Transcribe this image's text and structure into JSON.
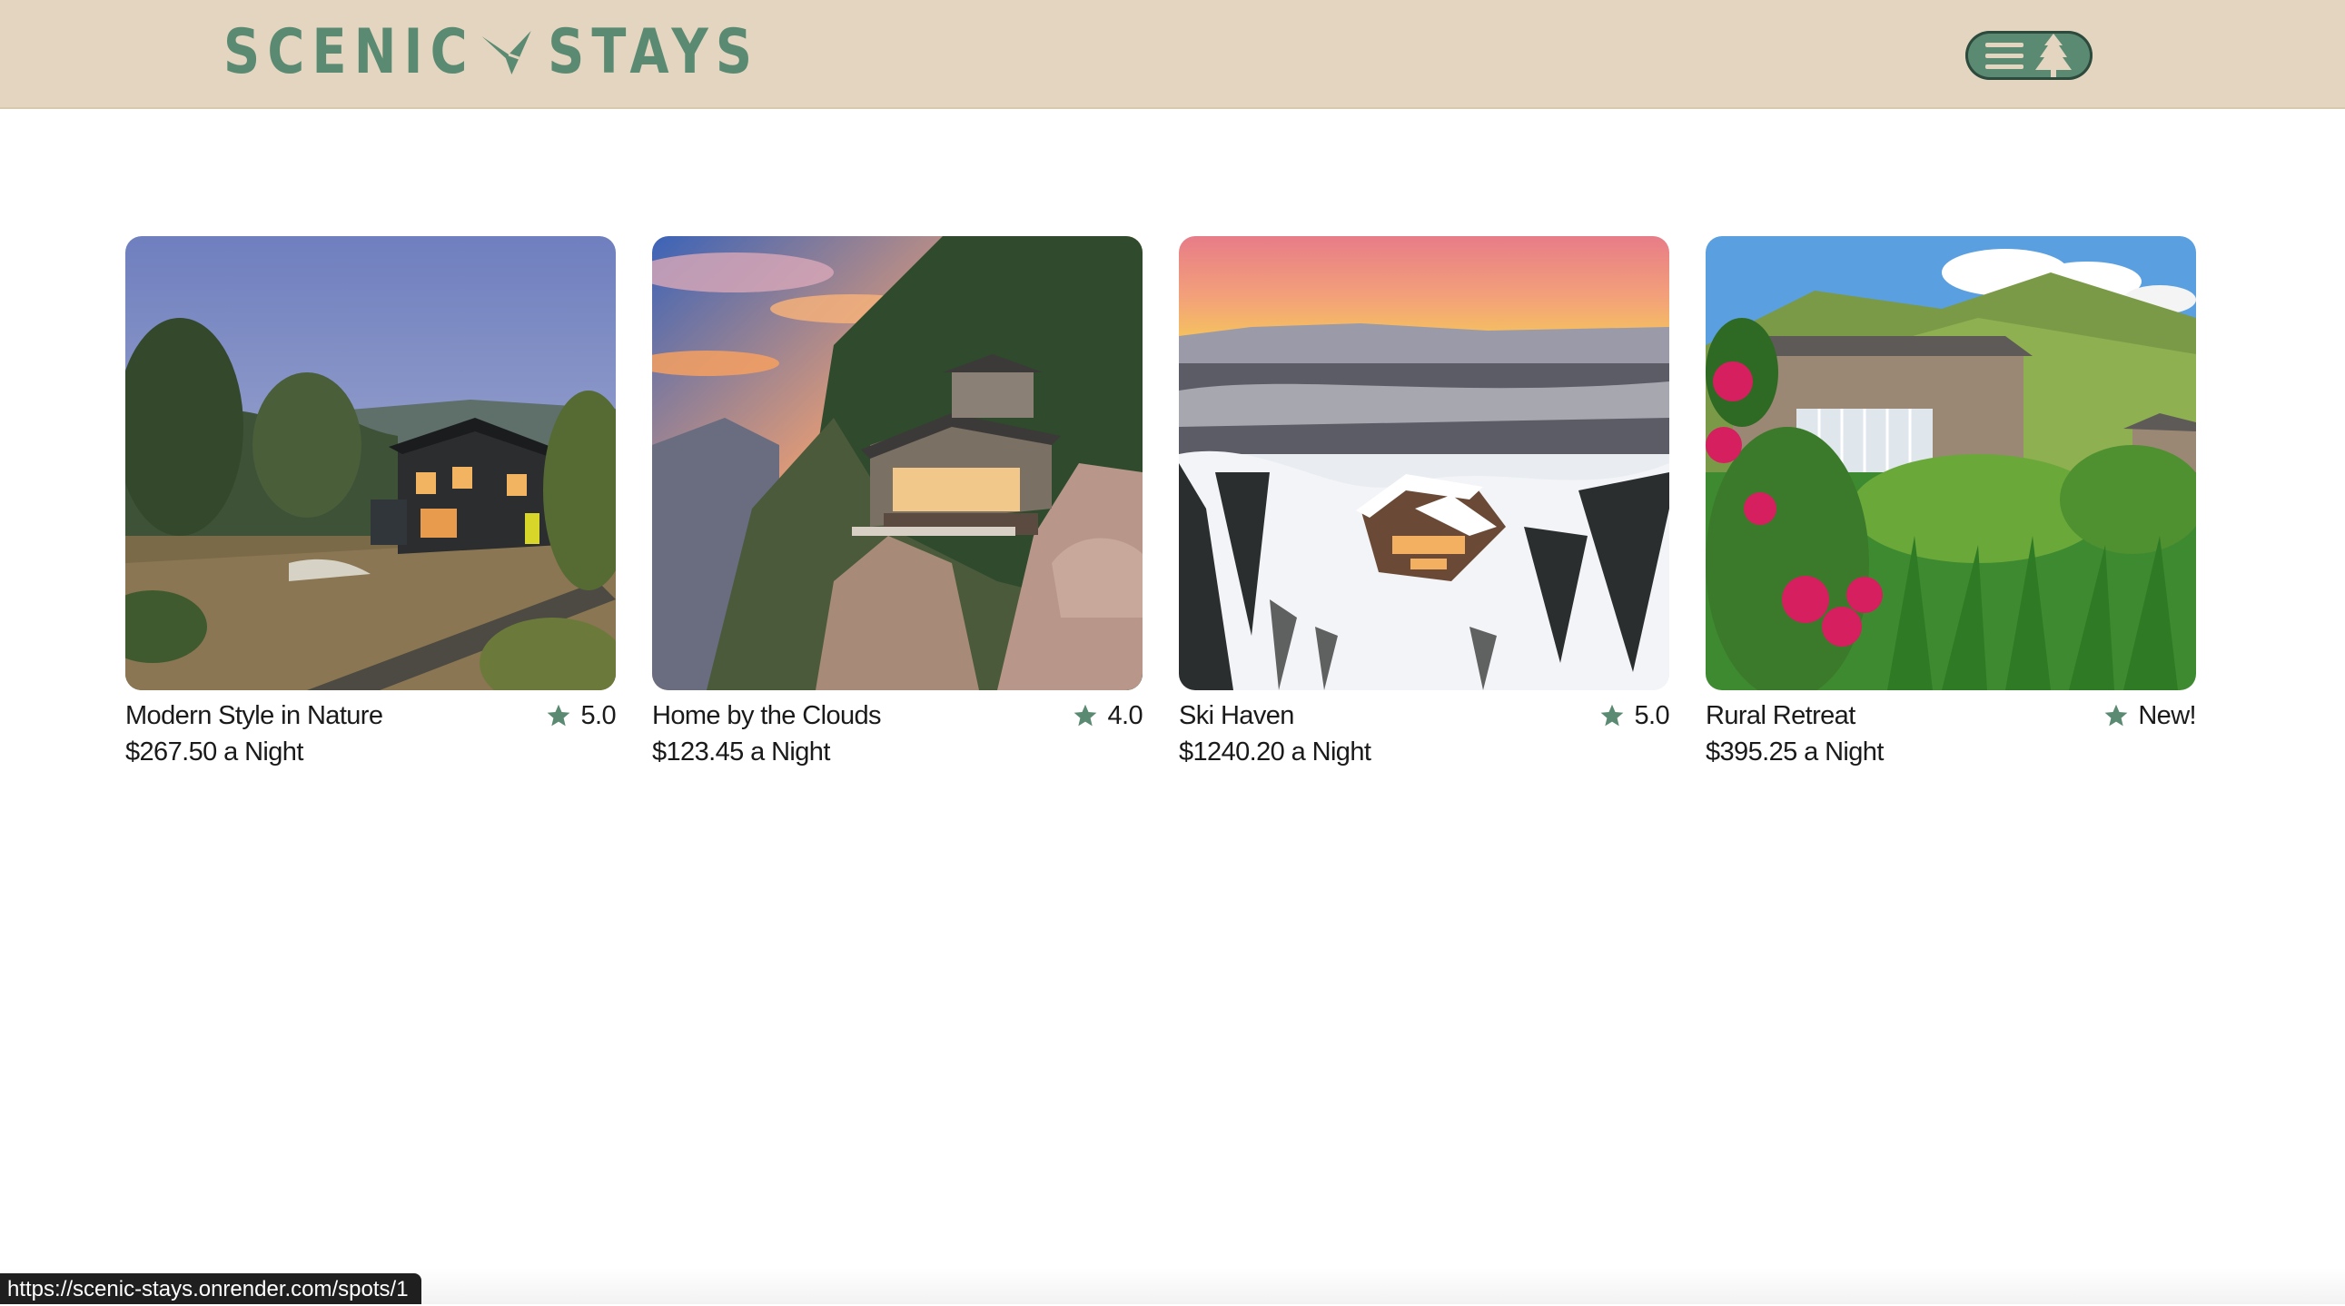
{
  "brand": {
    "name_left": "SCENIC",
    "name_right": "STAYS",
    "color": "#5b8a72",
    "header_bg": "#e3d5bf"
  },
  "header": {
    "menu_icon": "hamburger-icon",
    "tree_icon": "tree-icon"
  },
  "spots": [
    {
      "title": "Modern Style in Nature",
      "rating": "5.0",
      "price": "$267.50 a Night",
      "image": "modern-cabin-in-nature"
    },
    {
      "title": "Home by the Clouds",
      "rating": "4.0",
      "price": "$123.45 a Night",
      "image": "cliffside-home"
    },
    {
      "title": "Ski Haven",
      "rating": "5.0",
      "price": "$1240.20 a Night",
      "image": "snowy-mountain-lodge"
    },
    {
      "title": "Rural Retreat",
      "rating": "New!",
      "price": "$395.25 a Night",
      "image": "countryside-stone-house"
    }
  ],
  "star_icon": "star-icon",
  "star_color": "#5b8a72",
  "status_url": "https://scenic-stays.onrender.com/spots/1"
}
